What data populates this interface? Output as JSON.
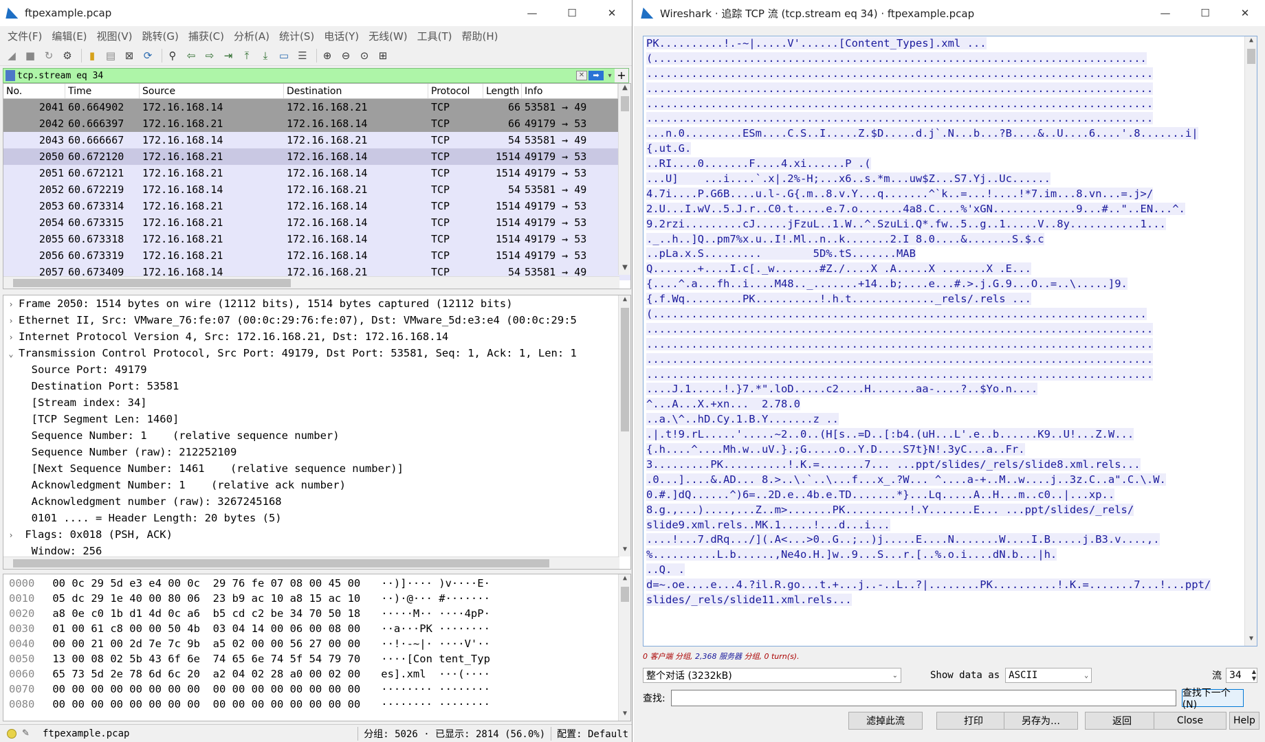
{
  "main": {
    "title": "ftpexample.pcap",
    "win_min": "—",
    "win_max": "☐",
    "win_close": "✕",
    "menu": [
      "文件(F)",
      "编辑(E)",
      "视图(V)",
      "跳转(G)",
      "捕获(C)",
      "分析(A)",
      "统计(S)",
      "电话(Y)",
      "无线(W)",
      "工具(T)",
      "帮助(H)"
    ],
    "filter": "tcp.stream eq 34",
    "columns": [
      "No.",
      "Time",
      "Source",
      "Destination",
      "Protocol",
      "Length",
      "Info"
    ],
    "packets": [
      {
        "no": "2041",
        "time": "60.664902",
        "src": "172.16.168.14",
        "dst": "172.16.168.21",
        "proto": "TCP",
        "len": "66",
        "info": "53581 → 49"
      },
      {
        "no": "2042",
        "time": "60.666397",
        "src": "172.16.168.21",
        "dst": "172.16.168.14",
        "proto": "TCP",
        "len": "66",
        "info": "49179 → 53"
      },
      {
        "no": "2043",
        "time": "60.666667",
        "src": "172.16.168.14",
        "dst": "172.16.168.21",
        "proto": "TCP",
        "len": "54",
        "info": "53581 → 49"
      },
      {
        "no": "2050",
        "time": "60.672120",
        "src": "172.16.168.21",
        "dst": "172.16.168.14",
        "proto": "TCP",
        "len": "1514",
        "info": "49179 → 53"
      },
      {
        "no": "2051",
        "time": "60.672121",
        "src": "172.16.168.21",
        "dst": "172.16.168.14",
        "proto": "TCP",
        "len": "1514",
        "info": "49179 → 53"
      },
      {
        "no": "2052",
        "time": "60.672219",
        "src": "172.16.168.14",
        "dst": "172.16.168.21",
        "proto": "TCP",
        "len": "54",
        "info": "53581 → 49"
      },
      {
        "no": "2053",
        "time": "60.673314",
        "src": "172.16.168.21",
        "dst": "172.16.168.14",
        "proto": "TCP",
        "len": "1514",
        "info": "49179 → 53"
      },
      {
        "no": "2054",
        "time": "60.673315",
        "src": "172.16.168.21",
        "dst": "172.16.168.14",
        "proto": "TCP",
        "len": "1514",
        "info": "49179 → 53"
      },
      {
        "no": "2055",
        "time": "60.673318",
        "src": "172.16.168.21",
        "dst": "172.16.168.14",
        "proto": "TCP",
        "len": "1514",
        "info": "49179 → 53"
      },
      {
        "no": "2056",
        "time": "60.673319",
        "src": "172.16.168.21",
        "dst": "172.16.168.14",
        "proto": "TCP",
        "len": "1514",
        "info": "49179 → 53"
      },
      {
        "no": "2057",
        "time": "60.673409",
        "src": "172.16.168.14",
        "dst": "172.16.168.21",
        "proto": "TCP",
        "len": "54",
        "info": "53581 → 49"
      }
    ],
    "detail": [
      {
        "tw": "›",
        "text": "Frame 2050: 1514 bytes on wire (12112 bits), 1514 bytes captured (12112 bits)"
      },
      {
        "tw": "›",
        "text": "Ethernet II, Src: VMware_76:fe:07 (00:0c:29:76:fe:07), Dst: VMware_5d:e3:e4 (00:0c:29:5"
      },
      {
        "tw": "›",
        "text": "Internet Protocol Version 4, Src: 172.16.168.21, Dst: 172.16.168.14"
      },
      {
        "tw": "⌄",
        "text": "Transmission Control Protocol, Src Port: 49179, Dst Port: 53581, Seq: 1, Ack: 1, Len: 1"
      },
      {
        "tw": "",
        "text": "  Source Port: 49179"
      },
      {
        "tw": "",
        "text": "  Destination Port: 53581"
      },
      {
        "tw": "",
        "text": "  [Stream index: 34]"
      },
      {
        "tw": "",
        "text": "  [TCP Segment Len: 1460]"
      },
      {
        "tw": "",
        "text": "  Sequence Number: 1    (relative sequence number)"
      },
      {
        "tw": "",
        "text": "  Sequence Number (raw): 212252109"
      },
      {
        "tw": "",
        "text": "  [Next Sequence Number: 1461    (relative sequence number)]"
      },
      {
        "tw": "",
        "text": "  Acknowledgment Number: 1    (relative ack number)"
      },
      {
        "tw": "",
        "text": "  Acknowledgment number (raw): 3267245168"
      },
      {
        "tw": "",
        "text": "  0101 .... = Header Length: 20 bytes (5)"
      },
      {
        "tw": "›",
        "text": " Flags: 0x018 (PSH, ACK)"
      },
      {
        "tw": "",
        "text": "  Window: 256"
      }
    ],
    "hex": [
      {
        "off": "0000",
        "bytes": "00 0c 29 5d e3 e4 00 0c  29 76 fe 07 08 00 45 00",
        "ascii": "··)]···· )v····E·"
      },
      {
        "off": "0010",
        "bytes": "05 dc 29 1e 40 00 80 06  23 b9 ac 10 a8 15 ac 10",
        "ascii": "··)·@··· #·······"
      },
      {
        "off": "0020",
        "bytes": "a8 0e c0 1b d1 4d 0c a6  b5 cd c2 be 34 70 50 18",
        "ascii": "·····M·· ····4pP·"
      },
      {
        "off": "0030",
        "bytes": "01 00 61 c8 00 00 50 4b  03 04 14 00 06 00 08 00",
        "ascii": "··a···PK ········"
      },
      {
        "off": "0040",
        "bytes": "00 00 21 00 2d 7e 7c 9b  a5 02 00 00 56 27 00 00",
        "ascii": "··!·-~|· ····V'··"
      },
      {
        "off": "0050",
        "bytes": "13 00 08 02 5b 43 6f 6e  74 65 6e 74 5f 54 79 70",
        "ascii": "····[Con tent_Typ"
      },
      {
        "off": "0060",
        "bytes": "65 73 5d 2e 78 6d 6c 20  a2 04 02 28 a0 00 02 00",
        "ascii": "es].xml  ···(····"
      },
      {
        "off": "0070",
        "bytes": "00 00 00 00 00 00 00 00  00 00 00 00 00 00 00 00",
        "ascii": "········ ········"
      },
      {
        "off": "0080",
        "bytes": "00 00 00 00 00 00 00 00  00 00 00 00 00 00 00 00",
        "ascii": "········ ········"
      }
    ],
    "status": {
      "file": "ftpexample.pcap",
      "packets": "分组: 5026 · 已显示: 2814 (56.0%)",
      "profile": "配置: Default"
    }
  },
  "follow": {
    "title": "Wireshark · 追踪 TCP 流 (tcp.stream eq 34) · ftpexample.pcap",
    "win_min": "—",
    "win_max": "☐",
    "win_close": "✕",
    "stream_lines": [
      "PK..........!.-~|.....V'......[Content_Types].xml ...",
      "(.............................................................................",
      "...............................................................................",
      "...............................................................................",
      "...............................................................................",
      "...............................................................................",
      "...n.0.........ESm....C.S..I.....Z.$D.....d.j`.N...b...?B....&..U....6....'.8.......i|",
      "{.ut.G.",
      "..RI....0.......F....4.xi......P .(",
      "...U]    ...i....`.x|.2%-H;...x6..s.*m...uw$Z...S7.Yj..Uc......",
      "4.7i....P.G6B....u.l-.G{.m..8.v.Y...q.......^`k..=...!....!*7.im...8.vn...=.j>/",
      "2.U...I.wV..5.J.r..C0.t.....e.7.o.......4a8.C....%'xGN.............9...#..\"..EN...^.",
      "9.2rzi.........cJ.....jFzuL..1.W..^.SzuLi.Q*.fw..5..g..1.....V..8y...........1...",
      "._..h..]Q..pm7%x.u..I!.Ml..n..k.......2.I 8.0....&.......S.$.c",
      "..pLa.x.S.........        5D%.tS.......MAB",
      "Q.......+....I.c[._w.......#Z./....X .A.....X .......X .E...",
      "{....^.a...fh..i....M48.._.......+14..b;....e...#.>.j.G.9...O..=..\\.....]9.",
      "{.f.Wq.........PK..........!.h.t............._rels/.rels ...",
      "(.............................................................................",
      "...............................................................................",
      "...............................................................................",
      "...............................................................................",
      "...............................................................................",
      "....J.1.....!.}7.*\".loD.....c2....H.......aa-....?..$Yo.n....",
      "^...A...X.+xn...  2.78.0",
      "..a.\\^..hD.Cy.1.B.Y.......z ..",
      ".|.t!9.rL.....'.....~2..0..(H[s..=D..[:b4.(uH...L'.e..b......K9..U!...Z.W...",
      "{.h....^....Mh.w..uV.}.;G.....o..Y.D....S7t}N!.3yC...a..Fr.",
      "3.........PK..........!.K.=.......7... ...ppt/slides/_rels/slide8.xml.rels...",
      ".0...]....&.AD... 8.>..\\.`..\\...f...x_.?W... ^....a-+..M..w....j..3z.C..a\".C.\\.W.",
      "0.#.]dQ......^)6=..2D.e..4b.e.TD.......*}...Lq.....A..H...m..c0..|...xp..",
      "8.g.,...)....,...Z..m>.......PK..........!.Y.......E... ...ppt/slides/_rels/",
      "slide9.xml.rels..MK.1.....!...d...i...",
      "....!...7.dRq.../](.A<...>0..G..;..)j.....E....N.......W....I.B.....j.B3.v....,.",
      "%..........L.b......,Ne4o.H.]w..9...S...r.[..%.o.i....dN.b...|h.",
      "..Q. .",
      "d=~.oe....e...4.?il.R.go...t.+...j..-..L..?|........PK..........!.K.=.......7...!...ppt/",
      "slides/_rels/slide11.xml.rels..."
    ],
    "stream_info": {
      "client_pkts": "0 客户端",
      "sep1": " 分组, ",
      "server_pkts": "2,368 服务器",
      "sep2": " 分组, ",
      "turns": "0 turn(s).",
      "sep3": ""
    },
    "conversation": "整个对话 (3232kB)",
    "show_as_label": "Show data as",
    "show_as_value": "ASCII",
    "stream_label": "流",
    "stream_value": "34",
    "find_label": "查找:",
    "find_next": "查找下一个(N)",
    "buttons": [
      "滤掉此流",
      "打印",
      "另存为…",
      "返回",
      "Close",
      "Help"
    ]
  }
}
